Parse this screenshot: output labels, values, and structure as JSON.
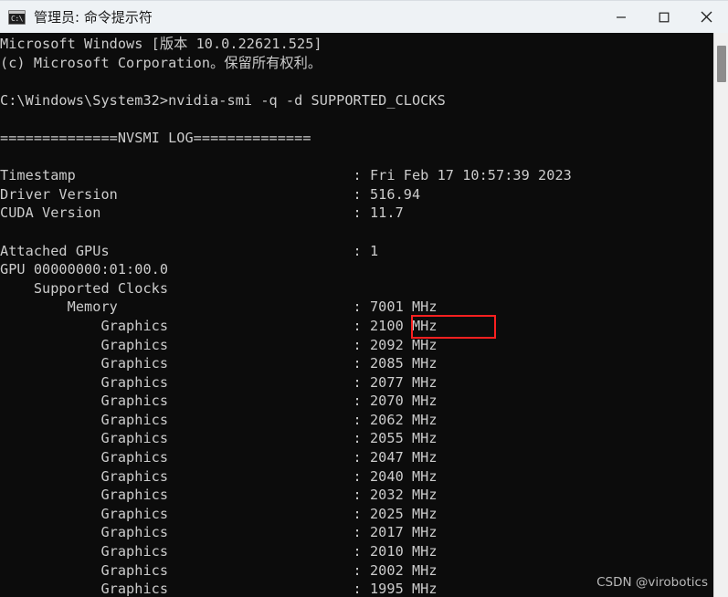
{
  "window": {
    "title": "管理员: 命令提示符",
    "icon": "cmd-icon",
    "icon_glyph": "C:\\",
    "background_color": "#0c0c0c",
    "titlebar_color": "#eef2f5",
    "text_color": "#cccccc"
  },
  "caption_buttons": [
    {
      "name": "minimize",
      "glyph": "—"
    },
    {
      "name": "maximize",
      "glyph": "□"
    },
    {
      "name": "close",
      "glyph": "✕"
    }
  ],
  "console": {
    "lines": [
      "Microsoft Windows [版本 10.0.22621.525]",
      "(c) Microsoft Corporation。保留所有权利。",
      "",
      "C:\\Windows\\System32>nvidia-smi -q -d SUPPORTED_CLOCKS",
      "",
      "==============NVSMI LOG==============",
      "",
      "Timestamp                                 : Fri Feb 17 10:57:39 2023",
      "Driver Version                            : 516.94",
      "CUDA Version                              : 11.7",
      "",
      "Attached GPUs                             : 1",
      "GPU 00000000:01:00.0",
      "    Supported Clocks",
      "        Memory                            : 7001 MHz",
      "            Graphics                      : 2100 MHz",
      "            Graphics                      : 2092 MHz",
      "            Graphics                      : 2085 MHz",
      "            Graphics                      : 2077 MHz",
      "            Graphics                      : 2070 MHz",
      "            Graphics                      : 2062 MHz",
      "            Graphics                      : 2055 MHz",
      "            Graphics                      : 2047 MHz",
      "            Graphics                      : 2040 MHz",
      "            Graphics                      : 2032 MHz",
      "            Graphics                      : 2025 MHz",
      "            Graphics                      : 2017 MHz",
      "            Graphics                      : 2010 MHz",
      "            Graphics                      : 2002 MHz",
      "            Graphics                      : 1995 MHz"
    ],
    "command": "nvidia-smi -q -d SUPPORTED_CLOCKS",
    "prompt": "C:\\Windows\\System32>",
    "os_version": "Microsoft Windows [版本 10.0.22621.525]",
    "copyright": "(c) Microsoft Corporation。保留所有权利。",
    "log_header": "==============NVSMI LOG==============",
    "fields": {
      "timestamp": "Fri Feb 17 10:57:39 2023",
      "driver_version": "516.94",
      "cuda_version": "11.7",
      "attached_gpus": "1",
      "gpu_id": "GPU 00000000:01:00.0",
      "supported_clocks_label": "Supported Clocks",
      "memory_label": "Memory",
      "memory_clock": "7001 MHz",
      "graphics_label": "Graphics"
    },
    "graphics_clocks": [
      "2100 MHz",
      "2092 MHz",
      "2085 MHz",
      "2077 MHz",
      "2070 MHz",
      "2062 MHz",
      "2055 MHz",
      "2047 MHz",
      "2040 MHz",
      "2032 MHz",
      "2025 MHz",
      "2017 MHz",
      "2010 MHz",
      "2002 MHz",
      "1995 MHz"
    ]
  },
  "annotation": {
    "highlight_value": "2100 MHz",
    "highlight_color": "#fb2020"
  },
  "watermark": {
    "text": "CSDN @virobotics"
  },
  "scrollbar": {
    "orientation": "vertical"
  }
}
